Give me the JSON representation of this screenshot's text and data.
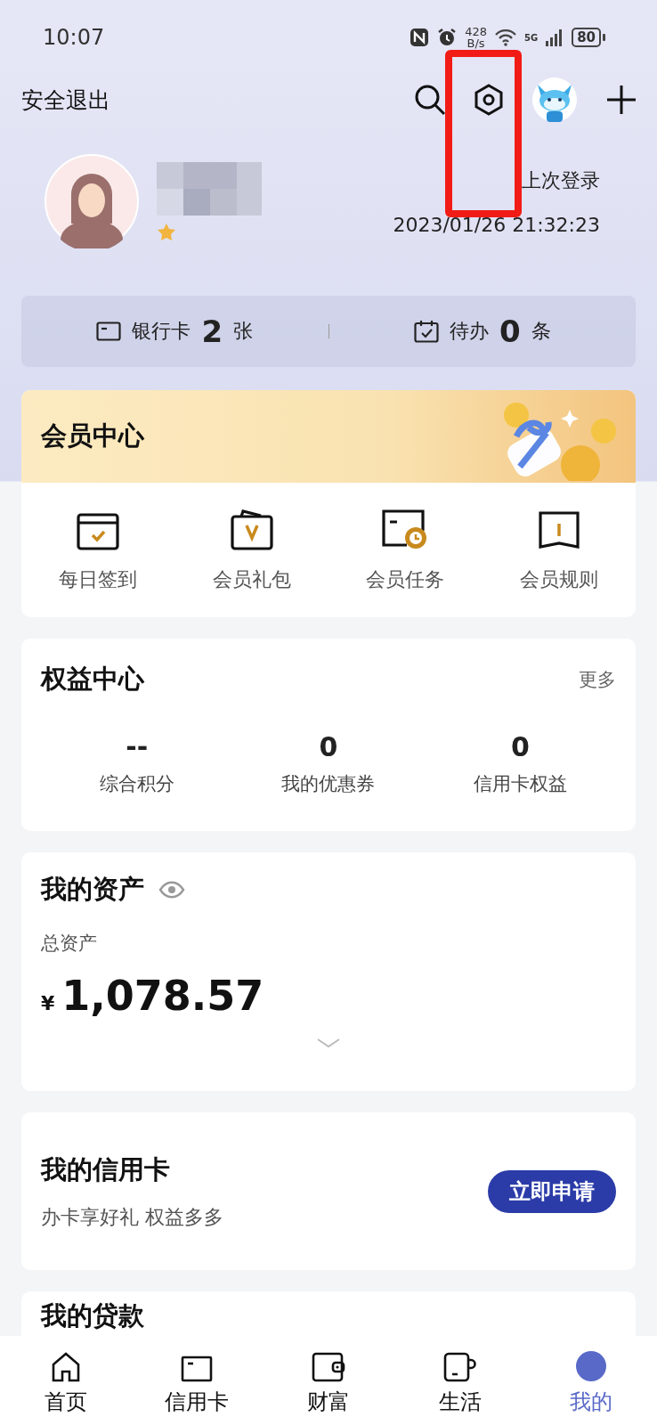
{
  "status_bar": {
    "time": "10:07",
    "net_speed": "428",
    "net_unit": "B/s",
    "network": "5G",
    "battery": "80"
  },
  "header": {
    "logout": "安全退出"
  },
  "profile": {
    "last_login_label": "上次登录",
    "last_login_time": "2023/01/26 21:32:23"
  },
  "summary": [
    {
      "kind": "card",
      "label": "银行卡",
      "count": "2",
      "unit": "张"
    },
    {
      "kind": "todo",
      "label": "待办",
      "count": "0",
      "unit": "条"
    }
  ],
  "member_center": {
    "title": "会员中心",
    "items": [
      {
        "kind": "checkin",
        "label": "每日签到"
      },
      {
        "kind": "gift",
        "label": "会员礼包"
      },
      {
        "kind": "task",
        "label": "会员任务"
      },
      {
        "kind": "rules",
        "label": "会员规则"
      }
    ]
  },
  "benefits": {
    "title": "权益中心",
    "more": "更多",
    "stats": [
      {
        "value": "--",
        "label": "综合积分"
      },
      {
        "value": "0",
        "label": "我的优惠券"
      },
      {
        "value": "0",
        "label": "信用卡权益"
      }
    ]
  },
  "assets": {
    "title": "我的资产",
    "total_label": "总资产",
    "currency": "¥",
    "amount": "1,078.57"
  },
  "credit_card": {
    "title": "我的信用卡",
    "subtitle": "办卡享好礼 权益多多",
    "button": "立即申请"
  },
  "loan": {
    "title": "我的贷款"
  },
  "tabs": [
    {
      "kind": "home",
      "label": "首页",
      "selected": false
    },
    {
      "kind": "card",
      "label": "信用卡",
      "selected": false
    },
    {
      "kind": "wealth",
      "label": "财富",
      "selected": false
    },
    {
      "kind": "life",
      "label": "生活",
      "selected": false
    },
    {
      "kind": "mine",
      "label": "我的",
      "selected": true
    }
  ]
}
